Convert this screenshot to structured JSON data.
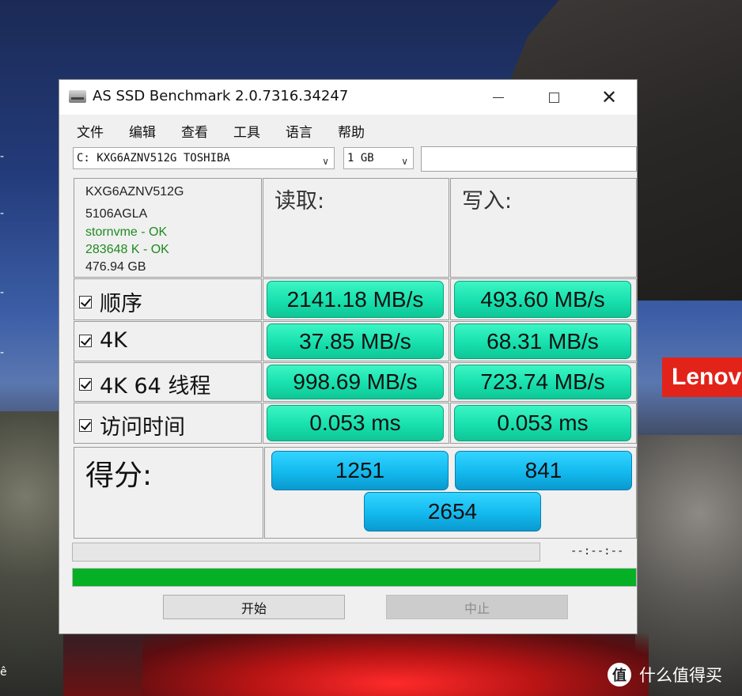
{
  "window": {
    "title": "AS SSD Benchmark 2.0.7316.34247",
    "controls": {
      "close": "✕"
    }
  },
  "menu": [
    "文件",
    "编辑",
    "查看",
    "工具",
    "语言",
    "帮助"
  ],
  "toolbar": {
    "drive_select": "C:  KXG6AZNV512G TOSHIBA",
    "size_select": "1 GB",
    "text_field_value": ""
  },
  "drive_info": {
    "model": "KXG6AZNV512G",
    "firmware": "5106AGLA",
    "driver_status": "stornvme - OK",
    "alignment_status": "283648 K - OK",
    "capacity": "476.94 GB"
  },
  "columns": {
    "read": "读取:",
    "write": "写入:"
  },
  "tests": [
    {
      "label": "顺序",
      "checked": true,
      "read": "2141.18 MB/s",
      "write": "493.60 MB/s"
    },
    {
      "label": "4K",
      "checked": true,
      "read": "37.85 MB/s",
      "write": "68.31 MB/s"
    },
    {
      "label": "4K 64 线程",
      "checked": true,
      "read": "998.69 MB/s",
      "write": "723.74 MB/s"
    },
    {
      "label": "访问时间",
      "checked": true,
      "read": "0.053 ms",
      "write": "0.053 ms"
    }
  ],
  "score": {
    "title": "得分:",
    "read": "1251",
    "write": "841",
    "total": "2654"
  },
  "progress": {
    "timer": "--:--:--",
    "overall_fraction": 1.0
  },
  "buttons": {
    "start": "开始",
    "stop": "中止"
  },
  "desktop": {
    "lenovo_logo": "Lenovo",
    "watermark_icon": "值",
    "watermark_text": "什么值得买",
    "edge_marks": [
      "·",
      "-",
      "-",
      "-",
      "-",
      "-",
      "ê"
    ]
  },
  "colors": {
    "result_green": "#17e0ae",
    "score_blue": "#13b9ee",
    "progress_green": "#06b025",
    "ok_text": "#1f8a1f",
    "lenovo_red": "#e2231a"
  }
}
